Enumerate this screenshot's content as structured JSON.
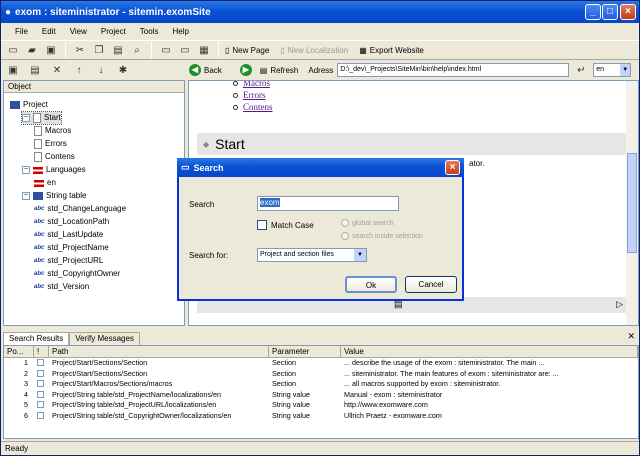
{
  "window": {
    "title": "exom : siteministrator - sitemin.exomSite"
  },
  "menu": [
    "File",
    "Edit",
    "View",
    "Project",
    "Tools",
    "Help"
  ],
  "toolbar": {
    "new_page": "New Page",
    "new_localization": "New Localization",
    "export_website": "Export Website"
  },
  "nav": {
    "back": "Back",
    "refresh": "Refresh",
    "address_label": "Adress",
    "address_value": "D:\\_dev\\_Projects\\SiteMin\\bin\\help\\index.html",
    "language": "en"
  },
  "tree": {
    "header": "Object",
    "items": [
      {
        "label": "Project",
        "level": 0
      },
      {
        "label": "Start",
        "level": 1
      },
      {
        "label": "Macros",
        "level": 2
      },
      {
        "label": "Errors",
        "level": 2
      },
      {
        "label": "Contens",
        "level": 2
      },
      {
        "label": "Languages",
        "level": 1
      },
      {
        "label": "en",
        "level": 2
      },
      {
        "label": "String table",
        "level": 1
      },
      {
        "label": "std_ChangeLanguage",
        "level": 2
      },
      {
        "label": "std_LocationPath",
        "level": 2
      },
      {
        "label": "std_LastUpdate",
        "level": 2
      },
      {
        "label": "std_ProjectName",
        "level": 2
      },
      {
        "label": "std_ProjectURL",
        "level": 2
      },
      {
        "label": "std_CopyrightOwner",
        "level": 2
      },
      {
        "label": "std_Version",
        "level": 2
      }
    ]
  },
  "content": {
    "links": [
      "Macros",
      "Errors",
      "Contens"
    ],
    "heading": "Start",
    "text_fragment": "ator."
  },
  "dialog": {
    "title": "Search",
    "search_label": "Search",
    "search_value": "exom",
    "match_case": "Match Case",
    "global_search": "global search",
    "search_inside": "search inside selection",
    "search_for_label": "Search for:",
    "search_for_value": "Project and section files",
    "ok": "Ok",
    "cancel": "Cancel"
  },
  "tabs": [
    "Search Results",
    "Verify Messages"
  ],
  "results": {
    "headers": [
      "Po...",
      "!",
      "Path",
      "Parameter",
      "Value"
    ],
    "rows": [
      {
        "pos": "1",
        "path": "Project/Start/Sections/Section",
        "param": "Section",
        "value": "... describe the usage of the exom : siteministrator.  The main ..."
      },
      {
        "pos": "2",
        "path": "Project/Start/Sections/Section",
        "param": "Section",
        "value": "... siteministrator.  The main features of exom : siteministrator are:  ..."
      },
      {
        "pos": "3",
        "path": "Project/Start/Macros/Sections/macros",
        "param": "Section",
        "value": "... all macros supported by exom : siteministrator."
      },
      {
        "pos": "4",
        "path": "Project/String table/std_ProjectName/localizations/en",
        "param": "String value",
        "value": "Manual - exom : siteministrator"
      },
      {
        "pos": "5",
        "path": "Project/String table/std_ProjectURL/localizations/en",
        "param": "String value",
        "value": "http://www.exomware.com"
      },
      {
        "pos": "6",
        "path": "Project/String table/std_CopyrightOwner/localizations/en",
        "param": "String value",
        "value": "Ullrich Praetz - exomware.com"
      }
    ]
  },
  "status": "Ready"
}
